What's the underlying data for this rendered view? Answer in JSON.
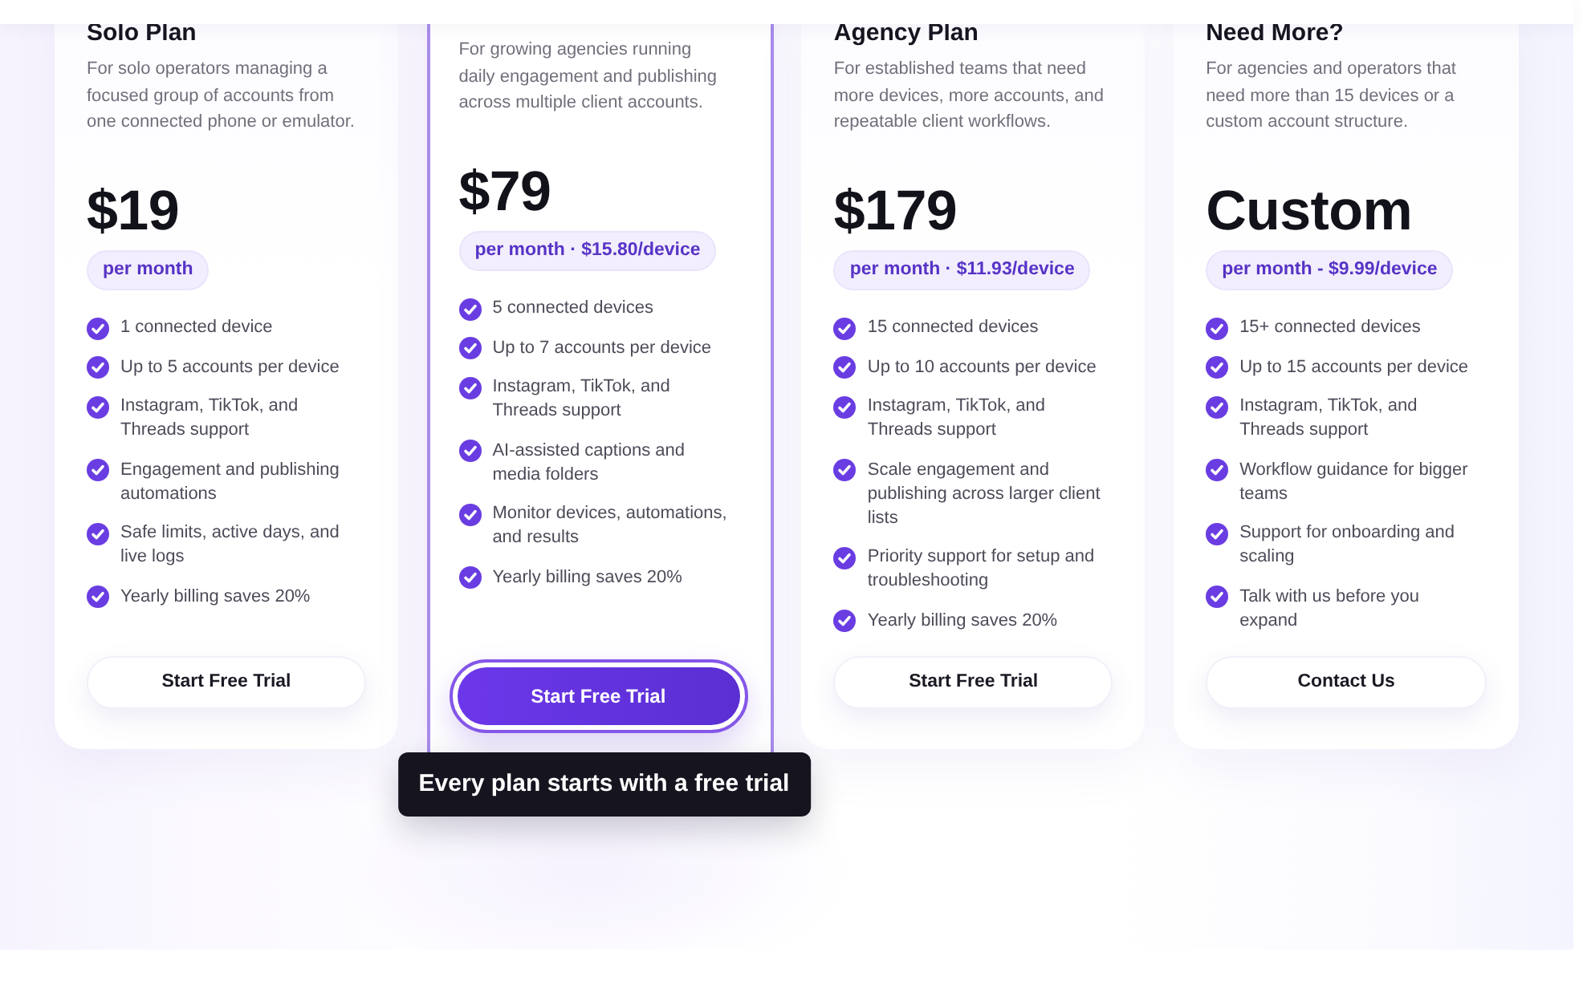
{
  "plans": [
    {
      "title": "Solo Plan",
      "description": "For solo operators managing a focused group of accounts from one connected phone or emulator.",
      "price": "$19",
      "billing": "per month",
      "featured": false,
      "features": [
        "1 connected device",
        "Up to 5 accounts per device",
        "Instagram, TikTok, and Threads support",
        "Engagement and publishing automations",
        "Safe limits, active days, and live logs",
        "Yearly billing saves 20%"
      ],
      "button": "Start Free Trial"
    },
    {
      "description": "For growing agencies running daily engagement and publishing across multiple client accounts.",
      "price": "$79",
      "billing": "per month · $15.80/device",
      "featured": true,
      "features": [
        "5 connected devices",
        "Up to 7 accounts per device",
        "Instagram, TikTok, and Threads support",
        "AI-assisted captions and media folders",
        "Monitor devices, automations, and results",
        "Yearly billing saves 20%"
      ],
      "button": "Start Free Trial",
      "tooltip": "Every plan starts with a free trial"
    },
    {
      "title": "Agency Plan",
      "description": "For established teams that need more devices, more accounts, and repeatable client workflows.",
      "price": "$179",
      "billing": "per month · $11.93/device",
      "featured": false,
      "features": [
        "15 connected devices",
        "Up to 10 accounts per device",
        "Instagram, TikTok, and Threads support",
        "Scale engagement and publishing across larger client lists",
        "Priority support for setup and troubleshooting",
        "Yearly billing saves 20%"
      ],
      "button": "Start Free Trial"
    },
    {
      "title": "Need More?",
      "description": "For agencies and operators that need more than 15 devices or a custom account structure.",
      "price": "Custom",
      "billing": "per month - $9.99/device",
      "featured": false,
      "features": [
        "15+ connected devices",
        "Up to 15 accounts per device",
        "Instagram, TikTok, and Threads support",
        "Workflow guidance for bigger teams",
        "Support for onboarding and scaling",
        "Talk with us before you expand"
      ],
      "button": "Contact Us"
    }
  ]
}
